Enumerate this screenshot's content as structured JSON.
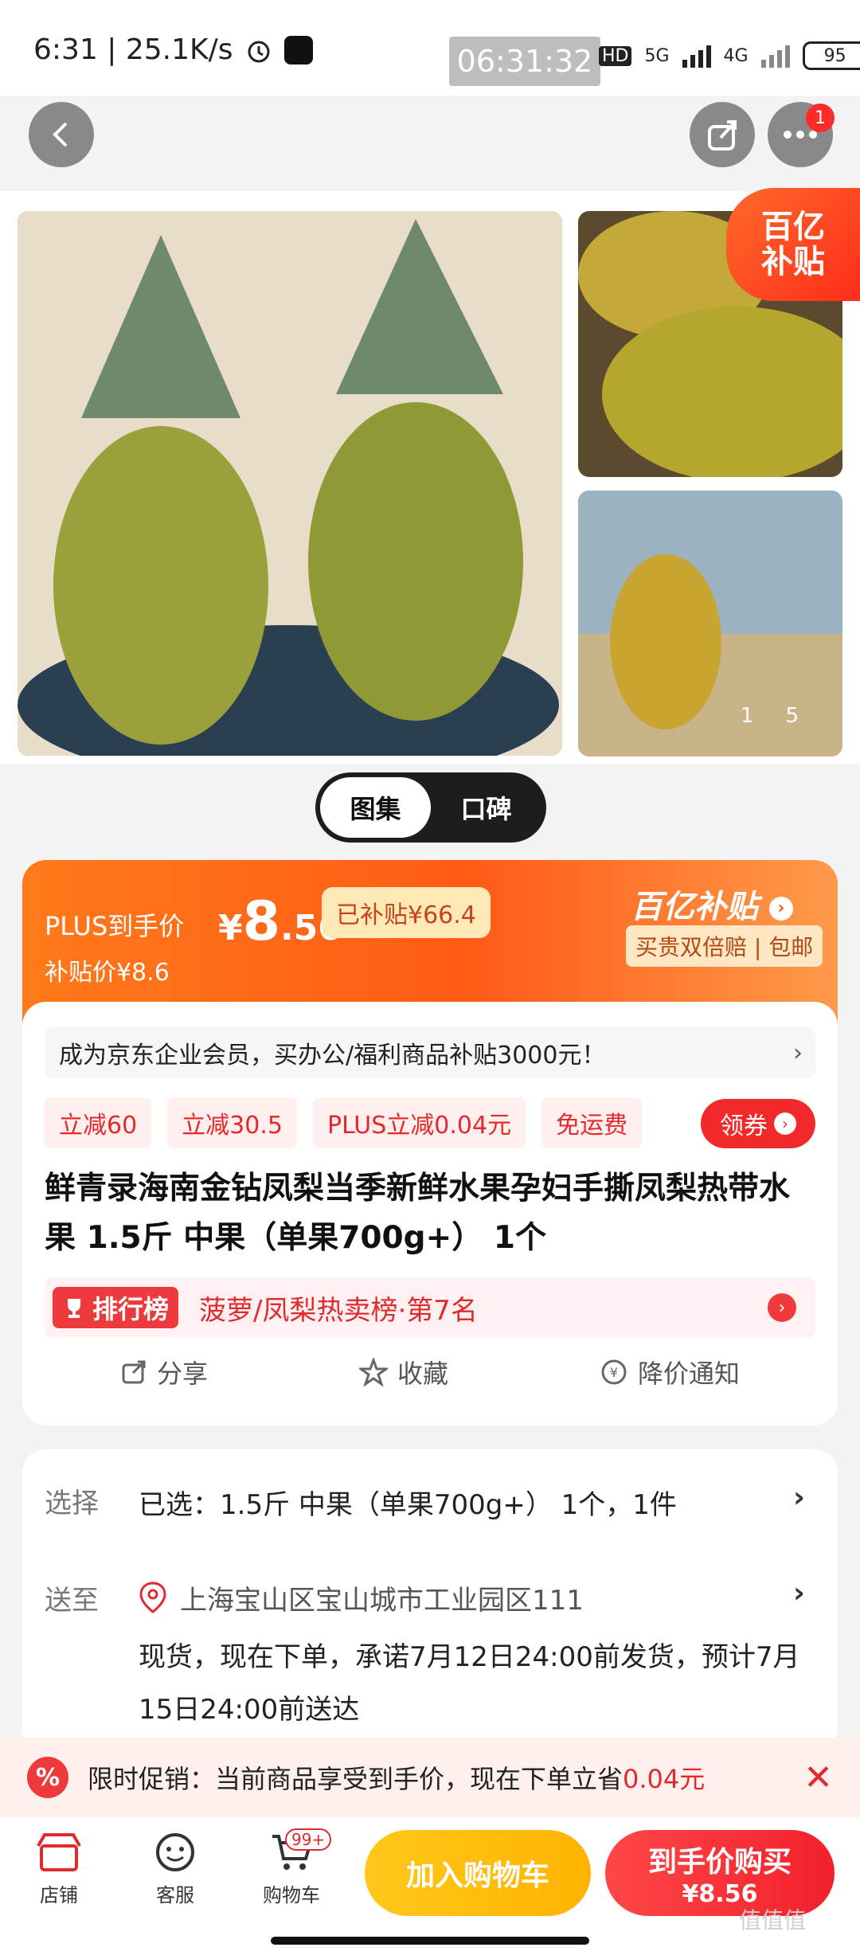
{
  "status_bar": {
    "time_text": "6:31 | 25.1K/s",
    "clock": "06:31:32",
    "net1": "HD",
    "net2": "5G",
    "net3": "4G",
    "battery": "95"
  },
  "nav": {
    "notification_count": "1"
  },
  "gallery": {
    "page_indicator_current": "1",
    "page_indicator_total": "5",
    "subsidy_badge_line1": "百亿",
    "subsidy_badge_line2": "补贴",
    "tabs": [
      {
        "label": "图集",
        "active": true
      },
      {
        "label": "口碑",
        "active": false
      }
    ]
  },
  "price": {
    "plus_label": "PLUS到手价",
    "currency": "¥",
    "amount_int": "8",
    "amount_dec": ".56",
    "subsidized": "已补贴¥66.4",
    "sub_price": "补贴价¥8.6",
    "brand": "百亿补贴",
    "guarantee": "买贵双倍赔 | 包邮"
  },
  "product": {
    "enterprise_banner": "成为京东企业会员，买办公/福利商品补贴3000元！",
    "coupons": [
      "立减60",
      "立减30.5",
      "PLUS立减0.04元",
      "免运费"
    ],
    "claim_button": "领券",
    "title": "鲜青录海南金钻凤梨当季新鲜水果孕妇手撕凤梨热带水果 1.5斤 中果（单果700g+） 1个",
    "rank_tag": "排行榜",
    "rank_text": "菠萝/凤梨热卖榜·第7名",
    "actions": [
      {
        "label": "分享",
        "icon": "share-icon"
      },
      {
        "label": "收藏",
        "icon": "star-icon"
      },
      {
        "label": "降价通知",
        "icon": "price-drop-icon"
      }
    ]
  },
  "details": {
    "select_label": "选择",
    "select_value": "已选：1.5斤 中果（单果700g+） 1个，1件",
    "ship_label": "送至",
    "address": "上海宝山区宝山城市工业园区111",
    "delivery_note": "现货，现在下单，承诺7月12日24:00前发货，预计7月15日24:00前送达"
  },
  "promo": {
    "icon_text": "%",
    "text": "限时促销：当前商品享受到手价，现在下单立省",
    "highlight": "0.04元",
    "close": "✕"
  },
  "bottom_bar": {
    "store": "店铺",
    "service": "客服",
    "cart": "购物车",
    "cart_badge": "99+",
    "add_to_cart": "加入购物车",
    "buy_now": "到手价购买",
    "buy_now_price": "¥8.56"
  },
  "watermark": "值值值",
  "colors": {
    "brand_orange": "#ff5a17",
    "brand_red": "#f2292b",
    "cart_yellow": "#ffc81a"
  }
}
